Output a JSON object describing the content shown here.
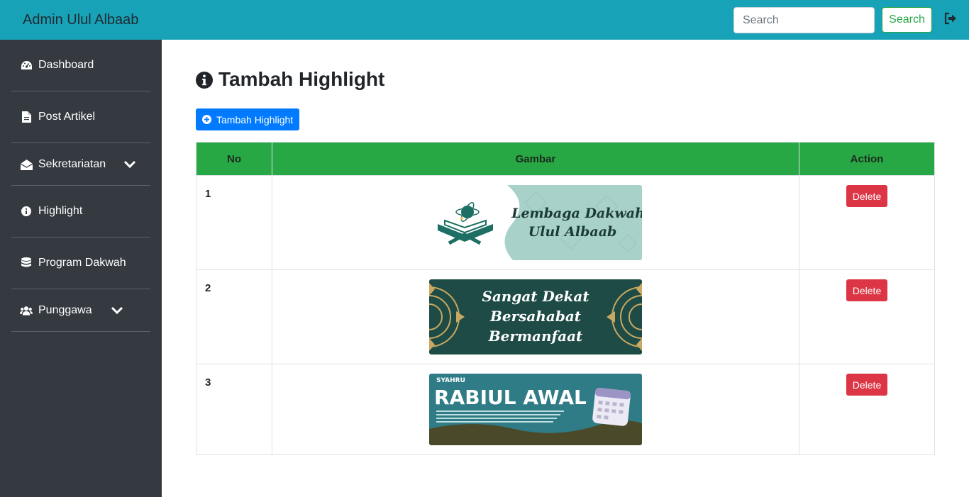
{
  "header": {
    "brand": "Admin Ulul Albaab",
    "search_placeholder": "Search",
    "search_button": "Search",
    "logout_icon": "sign-out-icon",
    "bg_color": "#17a2b8"
  },
  "sidebar": {
    "items": [
      {
        "label": "Dashboard",
        "icon": "tachometer-icon"
      },
      {
        "label": "Post Artikel",
        "icon": "file-icon"
      },
      {
        "label": "Sekretariatan",
        "icon": "envelope-open-icon",
        "has_dropdown": true
      },
      {
        "label": "Highlight",
        "icon": "info-circle-icon"
      },
      {
        "label": "Program Dakwah",
        "icon": "database-icon"
      },
      {
        "label": "Punggawa",
        "icon": "users-icon",
        "has_dropdown": true
      }
    ]
  },
  "main": {
    "title": "Tambah Highlight",
    "add_button": "Tambah Highlight",
    "table": {
      "headers": [
        "No",
        "Gambar",
        "Action"
      ],
      "rows": [
        {
          "no": "1",
          "image": "Lembaga Dakwah Ulul Albaab banner",
          "image_lines": [
            "Lembaga Dakwah",
            "Ulul Albaab"
          ],
          "action": "Delete"
        },
        {
          "no": "2",
          "image": "Sangat Dekat Bersahabat Bermanfaat banner",
          "image_lines": [
            "Sangat Dekat",
            "Bersahabat",
            "Bermanfaat"
          ],
          "action": "Delete"
        },
        {
          "no": "3",
          "image": "Syahru Rabiul Awal banner",
          "image_lines": [
            "SYAHRU",
            "RABIUL AWAL"
          ],
          "action": "Delete"
        }
      ]
    }
  },
  "colors": {
    "primary": "#007bff",
    "success": "#28a745",
    "danger": "#dc3545",
    "sidebar": "#343a40"
  }
}
